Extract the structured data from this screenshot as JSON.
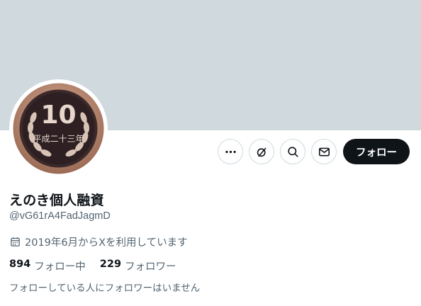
{
  "colors": {
    "banner": "#cfd9de",
    "follow_bg": "#0f1419",
    "secondary_text": "#536471"
  },
  "avatar": {
    "coin_number": "10",
    "coin_era_text": "平成二十三年",
    "icon": "ten-yen-coin-icon"
  },
  "actions": {
    "icons": [
      "more-icon",
      "grok-icon",
      "search-icon",
      "mail-icon"
    ],
    "follow_label": "フォロー"
  },
  "profile": {
    "name": "えのき個人融資",
    "handle": "@vG61rA4FadJagmD",
    "joined": "2019年6月からXを利用しています"
  },
  "stats": {
    "following_count": "894",
    "following_label": "フォロー中",
    "followers_count": "229",
    "followers_label": "フォロワー"
  },
  "notice": "フォローしている人にフォロワーはいません"
}
